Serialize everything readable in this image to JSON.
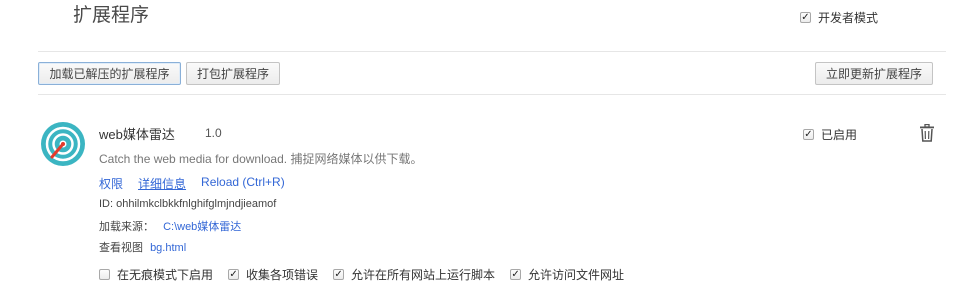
{
  "header": {
    "title": "扩展程序",
    "developer_mode": {
      "label": "开发者模式",
      "checked": true
    }
  },
  "toolbar": {
    "load_unpacked_label": "加载已解压的扩展程序",
    "pack_label": "打包扩展程序",
    "update_label": "立即更新扩展程序"
  },
  "extension": {
    "icon": "radar-icon",
    "name": "web媒体雷达",
    "version": "1.0",
    "description": "Catch the web media for download. 捕捉网络媒体以供下载。",
    "links": {
      "permissions": "权限",
      "details": "详细信息",
      "reload": "Reload (Ctrl+R)"
    },
    "id_line": "ID: ohhilmkclbkkfnlghifglmjndjieamof",
    "source_label": "加载来源：",
    "source_path": "C:\\web媒体雷达",
    "inspect_label": "查看视图",
    "inspect_link": "bg.html",
    "enabled_label": "已启用",
    "enabled_checked": true,
    "options": [
      {
        "label": "在无痕模式下启用",
        "checked": false
      },
      {
        "label": "收集各项错误",
        "checked": true
      },
      {
        "label": "允许在所有网站上运行脚本",
        "checked": true
      },
      {
        "label": "允许访问文件网址",
        "checked": true
      }
    ]
  },
  "colors": {
    "link": "#3367d6",
    "icon_teal": "#3bb5c2",
    "icon_red": "#e23a2c"
  }
}
